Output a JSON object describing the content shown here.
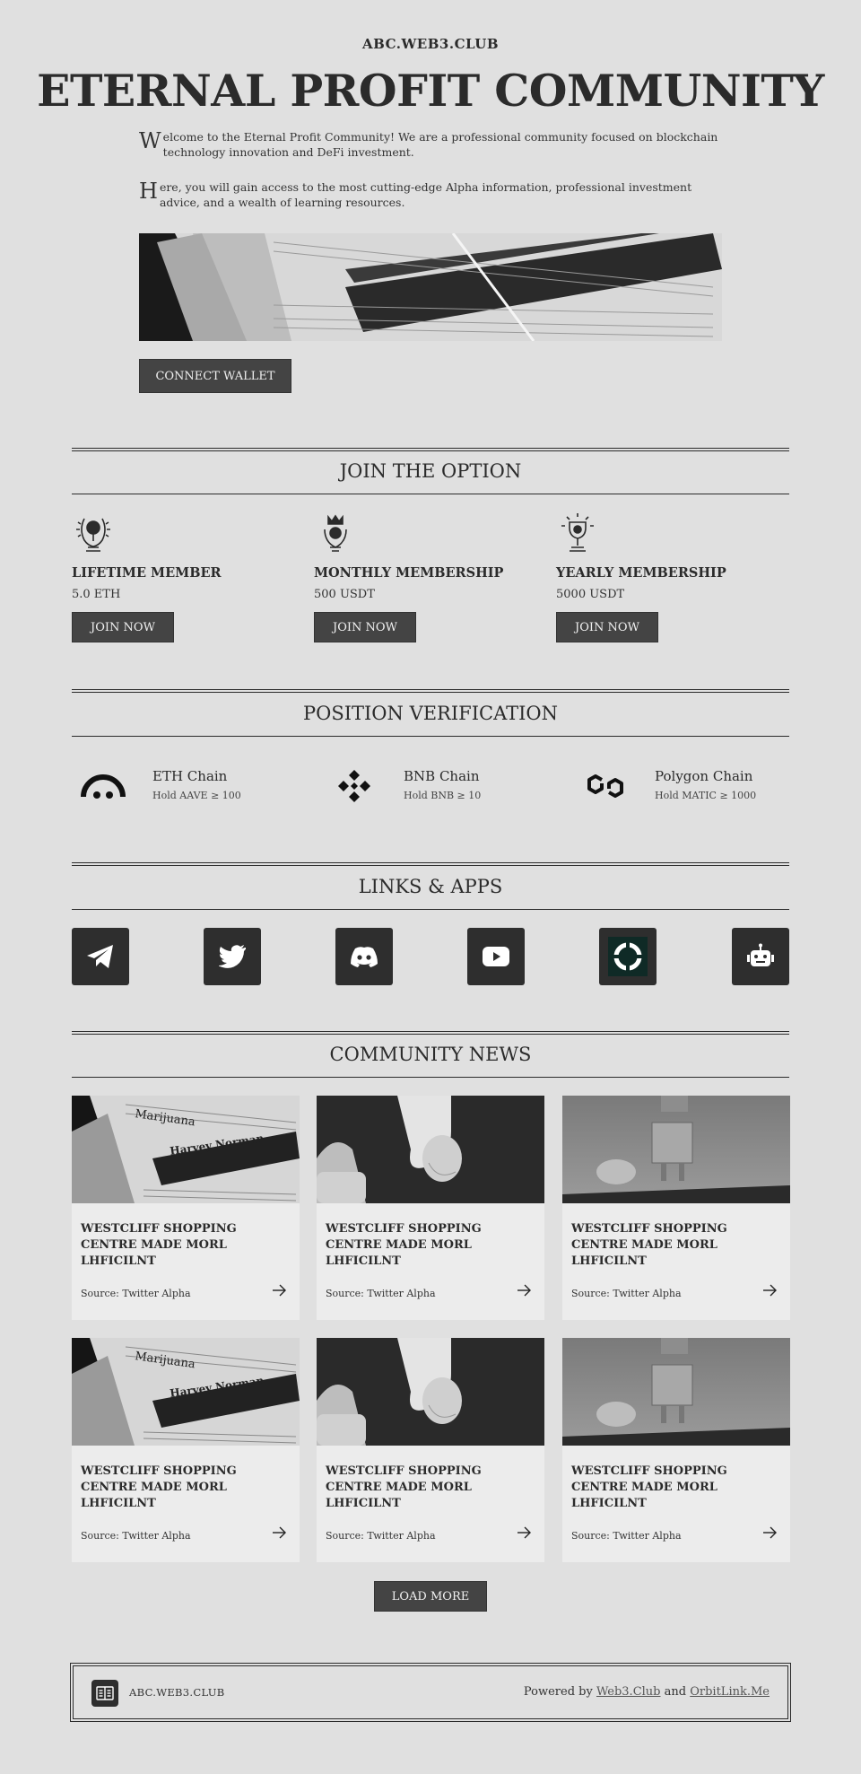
{
  "site": {
    "name": "ABC.WEB3.CLUB"
  },
  "hero": {
    "title": "ETERNAL PROFIT COMMUNITY",
    "para1_initial": "W",
    "para1_rest": "elcome to the Eternal Profit Community! We are a professional community focused on blockchain technology innovation and DeFi investment.",
    "para2_initial": "H",
    "para2_rest": "ere, you will gain access to the most cutting-edge Alpha information, professional investment advice, and a wealth of learning resources.",
    "connect_label": "CONNECT WALLET"
  },
  "options": {
    "title": "JOIN THE OPTION",
    "plans": [
      {
        "name": "LIFETIME MEMBER",
        "price": "5.0 ETH",
        "button": "JOIN NOW",
        "icon": "laurel-trophy-icon"
      },
      {
        "name": "MONTHLY MEMBERSHIP",
        "price": "500 USDT",
        "button": "JOIN NOW",
        "icon": "crown-hands-icon"
      },
      {
        "name": "YEARLY MEMBERSHIP",
        "price": "5000 USDT",
        "button": "JOIN NOW",
        "icon": "shining-trophy-icon"
      }
    ]
  },
  "verification": {
    "title": "POSITION VERIFICATION",
    "chains": [
      {
        "name": "ETH Chain",
        "requirement": "Hold AAVE ≥ 100",
        "icon": "aave-icon"
      },
      {
        "name": "BNB Chain",
        "requirement": "Hold BNB ≥ 10",
        "icon": "bnb-icon"
      },
      {
        "name": "Polygon Chain",
        "requirement": "Hold MATIC ≥ 1000",
        "icon": "polygon-icon"
      }
    ]
  },
  "links": {
    "title": "LINKS & APPS",
    "apps": [
      "telegram-icon",
      "twitter-icon",
      "discord-icon",
      "youtube-icon",
      "app-ring-icon",
      "robot-icon"
    ]
  },
  "news": {
    "title": "COMMUNITY NEWS",
    "items": [
      {
        "title": "WESTCLIFF SHOPPING CENTRE MADE MORL LHFICILNT",
        "source": "Source: Twitter Alpha",
        "image": "newspaper"
      },
      {
        "title": "WESTCLIFF SHOPPING CENTRE MADE MORL LHFICILNT",
        "source": "Source: Twitter Alpha",
        "image": "robot-hand"
      },
      {
        "title": "WESTCLIFF SHOPPING CENTRE MADE MORL LHFICILNT",
        "source": "Source: Twitter Alpha",
        "image": "toy-robot"
      },
      {
        "title": "WESTCLIFF SHOPPING CENTRE MADE MORL LHFICILNT",
        "source": "Source: Twitter Alpha",
        "image": "newspaper"
      },
      {
        "title": "WESTCLIFF SHOPPING CENTRE MADE MORL LHFICILNT",
        "source": "Source: Twitter Alpha",
        "image": "robot-hand"
      },
      {
        "title": "WESTCLIFF SHOPPING CENTRE MADE MORL LHFICILNT",
        "source": "Source: Twitter Alpha",
        "image": "toy-robot"
      }
    ],
    "load_more": "LOAD MORE"
  },
  "footer": {
    "name": "ABC.WEB3.CLUB",
    "powered_prefix": "Powered by",
    "link1": "Web3.Club",
    "joiner": "and",
    "link2": "OrbitLink.Me"
  }
}
